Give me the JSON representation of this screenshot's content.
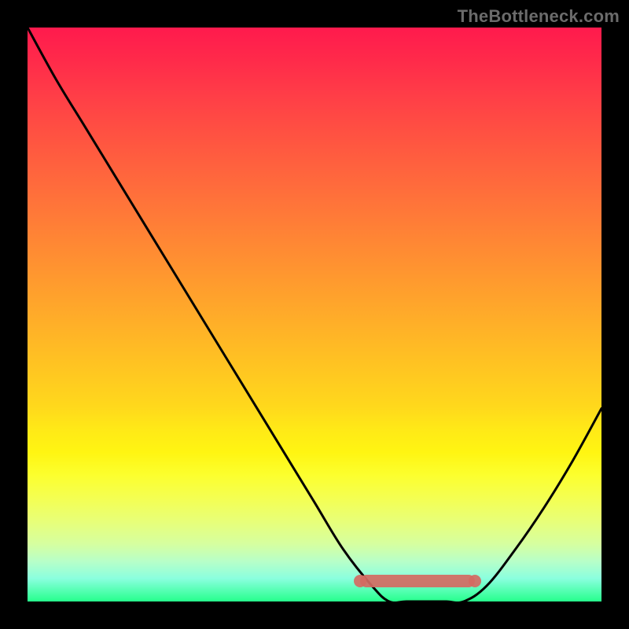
{
  "watermark": "TheBottleneck.com",
  "chart_data": {
    "type": "line",
    "title": "",
    "xlabel": "",
    "ylabel": "",
    "x": [
      0,
      5,
      10,
      15,
      20,
      25,
      30,
      35,
      40,
      45,
      50,
      55,
      60,
      63,
      66,
      70,
      73,
      76,
      80,
      85,
      90,
      95,
      100
    ],
    "values": [
      110,
      100,
      91,
      82,
      73,
      64,
      55,
      46,
      37,
      28,
      19,
      10,
      3,
      0,
      0,
      0,
      0,
      0,
      3,
      10,
      18,
      27,
      37
    ],
    "xlim": [
      0,
      100
    ],
    "ylim": [
      0,
      110
    ],
    "ideal_range_x": [
      58,
      78
    ],
    "annotations": [],
    "legend": []
  }
}
